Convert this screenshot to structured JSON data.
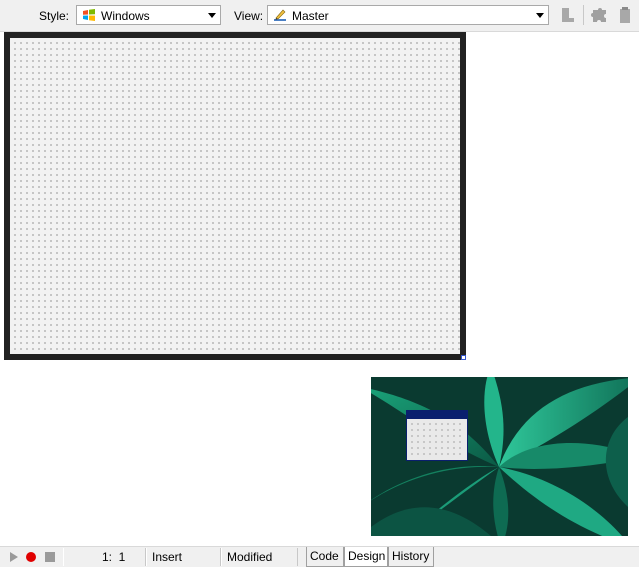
{
  "toolbar": {
    "style_label": "Style:",
    "style_value": "Windows",
    "style_icon": "windows-flag-icon",
    "view_label": "View:",
    "view_value": "Master",
    "view_icon": "pencil-ruler-icon",
    "buttons": [
      "document-icon",
      "puzzle-icon",
      "clipboard-icon"
    ]
  },
  "statusbar": {
    "buttons": [
      "play-icon",
      "record-icon",
      "stop-icon"
    ],
    "position": "1:  1",
    "mode": "Insert",
    "state": "Modified"
  },
  "tabs": [
    {
      "label": "Code",
      "active": false
    },
    {
      "label": "Design",
      "active": true
    },
    {
      "label": "History",
      "active": false
    }
  ],
  "colors": {
    "frame": "#222222",
    "grid_bg": "#f2f2f2",
    "mini_title": "#0a1f6e",
    "record": "#e00000"
  }
}
